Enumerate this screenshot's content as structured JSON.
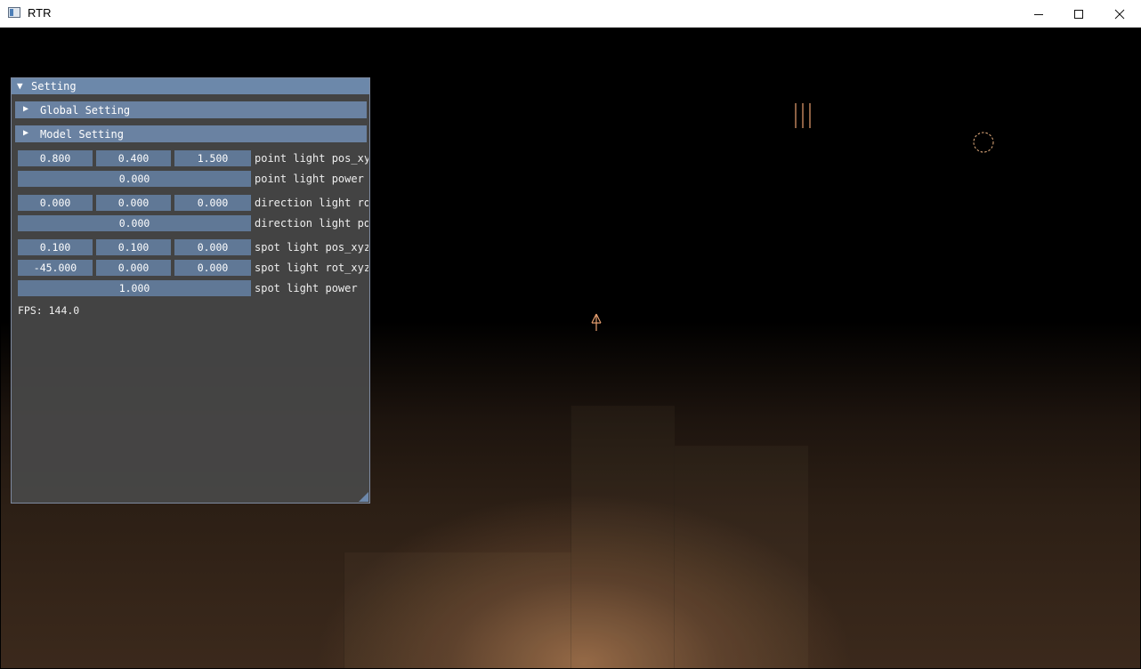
{
  "window": {
    "title": "RTR"
  },
  "panel": {
    "title": "Setting",
    "headers": [
      {
        "label": "Global Setting"
      },
      {
        "label": "Model Setting"
      }
    ],
    "rows": [
      {
        "label": "point light pos_xy",
        "values": [
          "0.800",
          "0.400",
          "1.500"
        ]
      },
      {
        "label": "point light power",
        "values": [
          "0.000"
        ]
      },
      {
        "label": "direction light ro",
        "values": [
          "0.000",
          "0.000",
          "0.000"
        ]
      },
      {
        "label": "direction light po",
        "values": [
          "0.000"
        ]
      },
      {
        "label": "spot light pos_xyz",
        "values": [
          "0.100",
          "0.100",
          "0.000"
        ]
      },
      {
        "label": "spot light rot_xyz",
        "values": [
          "-45.000",
          "0.000",
          "0.000"
        ]
      },
      {
        "label": "spot light power",
        "values": [
          "1.000"
        ]
      }
    ],
    "fps": "FPS: 144.0"
  },
  "gizmos": {
    "point_light": "dashed-circle-icon",
    "direction_light": "parallel-lines-icon",
    "spot_light": "arrow-up-icon",
    "color": "#e8a070"
  }
}
